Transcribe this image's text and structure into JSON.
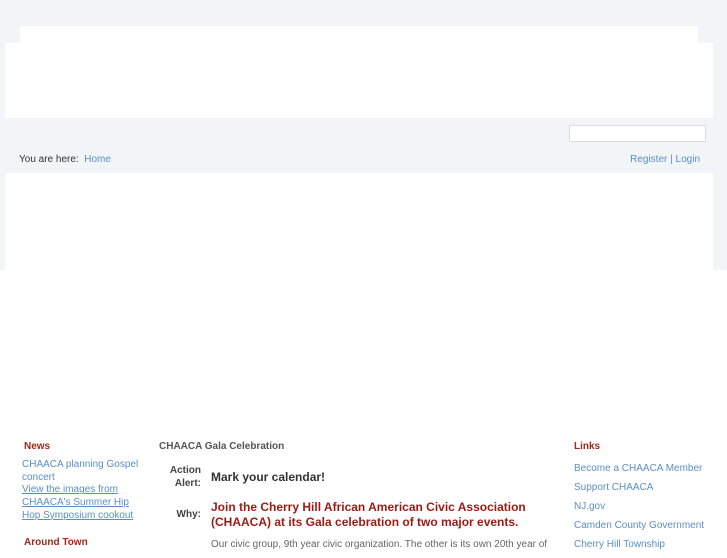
{
  "breadcrumb": {
    "label": "You are here:",
    "home": "Home"
  },
  "user_links": {
    "register": "Register",
    "separator": "|",
    "login": "Login"
  },
  "search": {
    "value": "",
    "placeholder": ""
  },
  "news": {
    "title": "News",
    "items": [
      {
        "text": "CHAACA planning Gospel concert",
        "underline": false
      },
      {
        "text": "View the images from CHAACA's Summer Hip Hop Symposium cookout",
        "underline": true
      }
    ]
  },
  "around_town": {
    "title": "Around Town"
  },
  "article": {
    "title": "CHAACA Gala Celebration",
    "action_label": "Action Alert:",
    "action_text": "Mark your calendar!",
    "why_label": "Why:",
    "why_text": "Join the Cherry Hill African American Civic Association (CHAACA) at its Gala celebration of two major events.",
    "body_partial": "Our civic group, 9th year civic organization. The other is its own 20th year of"
  },
  "links": {
    "title": "Links",
    "items": [
      "Become a CHAACA Member",
      "Support CHAACA",
      "NJ.gov",
      "Camden County Government",
      "Cherry Hill Township"
    ]
  }
}
